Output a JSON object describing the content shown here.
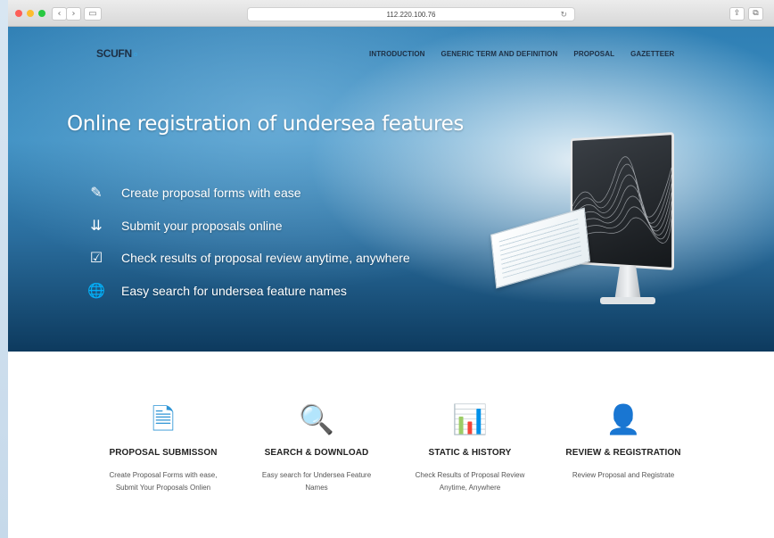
{
  "browser": {
    "address": "112.220.100.76",
    "reload_icon": "↻",
    "back_icon": "‹",
    "forward_icon": "›",
    "sidebar_icon": "▭",
    "share_icon": "⇪",
    "tabs_icon": "⧉",
    "colors": {
      "close": "#fd5f57",
      "minimize": "#fdbc2e",
      "zoom": "#28c840"
    }
  },
  "header": {
    "logo": "SCUFN",
    "nav": [
      "INTRODUCTION",
      "GENERIC TERM AND DEFINITION",
      "PROPOSAL",
      "GAZETTEER"
    ]
  },
  "hero": {
    "headline": "Online registration of undersea features",
    "features": [
      {
        "icon": "edit-icon",
        "glyph": "✎",
        "text": "Create proposal forms with ease"
      },
      {
        "icon": "submit-icon",
        "glyph": "⇊",
        "text": "Submit your proposals online"
      },
      {
        "icon": "checkbox-icon",
        "glyph": "☑",
        "text": "Check results of proposal review anytime, anywhere"
      },
      {
        "icon": "globe-search-icon",
        "glyph": "🌐",
        "text": "Easy search for undersea feature names"
      }
    ]
  },
  "cards": [
    {
      "icon": "document-icon",
      "glyph": "🗎",
      "title": "PROPOSAL SUBMISSON",
      "desc1": "Create Proposal Forms with ease,",
      "desc2": "Submit Your Proposals Onlien"
    },
    {
      "icon": "search-icon",
      "glyph": "🔍",
      "title": "SEARCH & DOWNLOAD",
      "desc1": "Easy search for Undersea Feature",
      "desc2": "Names"
    },
    {
      "icon": "bar-chart-icon",
      "glyph": "📊",
      "title": "STATIC & HISTORY",
      "desc1": "Check Results of Proposal Review",
      "desc2": "Anytime, Anywhere"
    },
    {
      "icon": "user-icon",
      "glyph": "👤",
      "title": "REVIEW & REGISTRATION",
      "desc1": "Review Proposal and Registrate",
      "desc2": ""
    }
  ],
  "accent_color": "#2f95d6"
}
